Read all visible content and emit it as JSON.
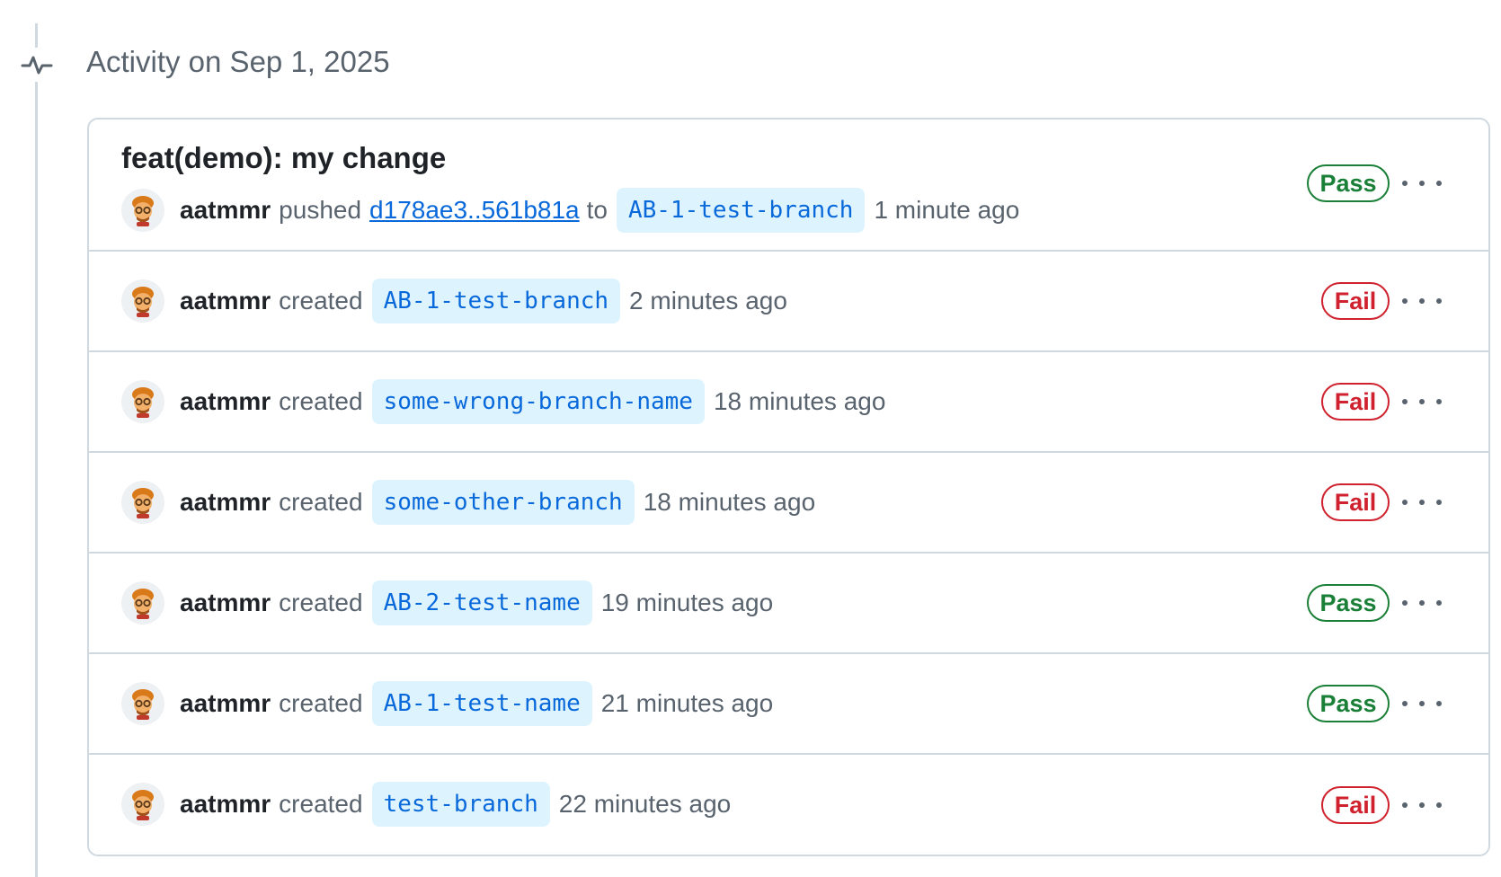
{
  "activity": {
    "title": "Activity on Sep 1, 2025"
  },
  "push": {
    "commit_title": "feat(demo): my change",
    "user": "aatmmr",
    "verb": "pushed",
    "commit_range": "d178ae3..561b81a",
    "to": "to",
    "branch": "AB-1-test-branch",
    "time": "1 minute ago",
    "status": "Pass"
  },
  "events": [
    {
      "user": "aatmmr",
      "verb": "created",
      "branch": "AB-1-test-branch",
      "time": "2 minutes ago",
      "status": "Fail"
    },
    {
      "user": "aatmmr",
      "verb": "created",
      "branch": "some-wrong-branch-name",
      "time": "18 minutes ago",
      "status": "Fail"
    },
    {
      "user": "aatmmr",
      "verb": "created",
      "branch": "some-other-branch",
      "time": "18 minutes ago",
      "status": "Fail"
    },
    {
      "user": "aatmmr",
      "verb": "created",
      "branch": "AB-2-test-name",
      "time": "19 minutes ago",
      "status": "Pass"
    },
    {
      "user": "aatmmr",
      "verb": "created",
      "branch": "AB-1-test-name",
      "time": "21 minutes ago",
      "status": "Pass"
    },
    {
      "user": "aatmmr",
      "verb": "created",
      "branch": "test-branch",
      "time": "22 minutes ago",
      "status": "Fail"
    }
  ],
  "colors": {
    "pass": "#1a7f37",
    "fail": "#cf222e",
    "link": "#0969da",
    "branch_bg": "#ddf4ff"
  },
  "icons": {
    "activity": "pulse-icon",
    "avatar": "user-avatar-icon",
    "more": "kebab-horizontal-icon"
  }
}
